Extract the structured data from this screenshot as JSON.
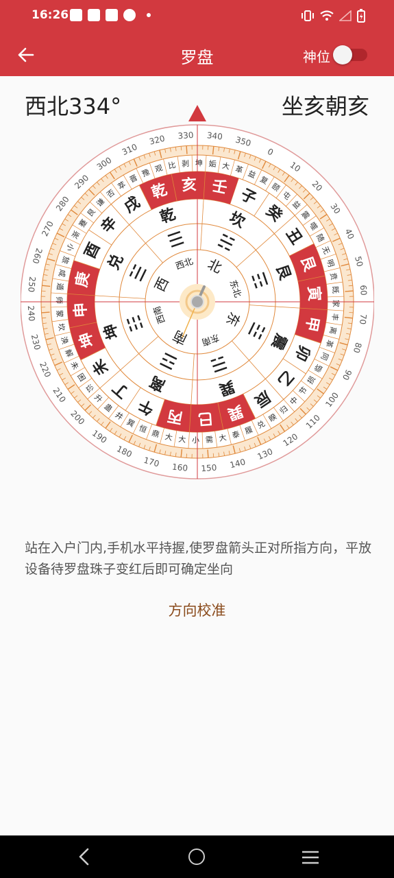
{
  "status": {
    "time": "16:26"
  },
  "header": {
    "title": "罗盘",
    "toggle_label": "神位",
    "toggle_on": false
  },
  "reading": {
    "direction": "西北334°",
    "orientation": "坐亥朝亥"
  },
  "compass": {
    "heading_deg": 334,
    "colors": {
      "red": "#d2393f",
      "orange": "#e0883a",
      "ring_tint": "#fbe7cf"
    },
    "degree_labels": [
      "0",
      "10",
      "20",
      "30",
      "40",
      "50",
      "60",
      "70",
      "80",
      "90",
      "100",
      "110",
      "120",
      "130",
      "140",
      "150",
      "160",
      "170",
      "180",
      "190",
      "200",
      "210",
      "220",
      "230",
      "240",
      "250",
      "260",
      "270",
      "280",
      "290",
      "300",
      "310",
      "320",
      "330",
      "340",
      "350"
    ],
    "mountains": [
      "子",
      "癸",
      "丑",
      "艮",
      "寅",
      "甲",
      "卯",
      "乙",
      "辰",
      "巽",
      "巳",
      "丙",
      "午",
      "丁",
      "未",
      "坤",
      "申",
      "庚",
      "酉",
      "辛",
      "戌",
      "乾",
      "亥",
      "壬"
    ],
    "trigrams": [
      "坎",
      "艮",
      "震",
      "巽",
      "离",
      "坤",
      "兑",
      "乾"
    ],
    "trigram_symbols": [
      "☵",
      "☶",
      "☳",
      "☴",
      "☲",
      "☷",
      "☱",
      "☰"
    ],
    "directions": [
      "北",
      "东北",
      "东",
      "东南",
      "南",
      "西南",
      "西",
      "西北"
    ],
    "hexagrams": [
      "复",
      "颐",
      "屯",
      "益",
      "震",
      "噬",
      "随",
      "无",
      "明",
      "贲",
      "既",
      "家",
      "丰",
      "离",
      "革",
      "同",
      "临",
      "损",
      "节",
      "中",
      "归",
      "睽",
      "兑",
      "履",
      "泰",
      "大",
      "需",
      "小",
      "大",
      "大",
      "鼎",
      "恒",
      "巽",
      "井",
      "蛊",
      "升",
      "讼",
      "困",
      "未",
      "解",
      "涣",
      "坎",
      "蒙",
      "师",
      "遁",
      "咸",
      "旅",
      "小",
      "渐",
      "蹇",
      "艮",
      "谦",
      "否",
      "萃",
      "晋",
      "豫",
      "观",
      "比",
      "剥",
      "坤",
      "姤",
      "大",
      "革",
      "益"
    ]
  },
  "instruction": "站在入户门内,手机水平持握,使罗盘箭头正对所指方向，平放设备待罗盘珠子变红后即可确定坐向",
  "calibrate_label": "方向校准"
}
